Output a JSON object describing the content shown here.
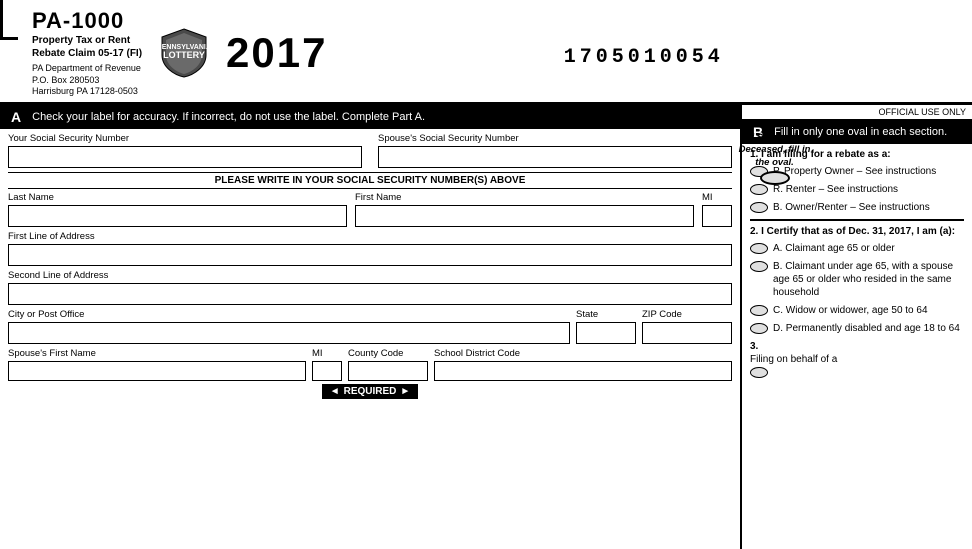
{
  "header": {
    "form_title": "PA-1000",
    "form_subtitle_line1": "Property Tax or Rent",
    "form_subtitle_line2": "Rebate Claim  05-17 (FI)",
    "dept_line1": "PA Department of Revenue",
    "dept_line2": "P.O. Box 280503",
    "dept_line3": "Harrisburg PA 17128-0503",
    "year": "2017",
    "barcode": "1705010054"
  },
  "sectionA": {
    "label": "A",
    "header_text": "Check your label for accuracy. If incorrect, do not use the label. Complete Part A.",
    "your_ssn_label": "Your Social Security Number",
    "spouse_ssn_label": "Spouse's Social Security Number",
    "deceased_label": "If Spouse is\nDeceased, fill\nin the oval.",
    "ssn_notice": "PLEASE WRITE IN YOUR SOCIAL SECURITY NUMBER(S) ABOVE",
    "last_name_label": "Last Name",
    "first_name_label": "First Name",
    "mi_label": "MI",
    "address1_label": "First Line of Address",
    "address2_label": "Second Line of Address",
    "city_label": "City or Post Office",
    "state_label": "State",
    "zip_label": "ZIP Code",
    "spouse_first_label": "Spouse's First Name",
    "spouse_mi_label": "MI",
    "county_label": "County Code",
    "school_district_label": "School District Code",
    "required_left_arrow": "◄",
    "required_text": "REQUIRED",
    "required_right_arrow": "►"
  },
  "sectionB": {
    "label": "B",
    "header_text": "Fill in only one oval in each section.",
    "official_use_text": "OFFICIAL USE ONLY",
    "question1": "1.  I am filing for a rebate as a:",
    "option_p": "P.  Property Owner – See instructions",
    "option_r": "R.  Renter – See instructions",
    "option_b": "B.  Owner/Renter – See instructions",
    "question2": "2.  I Certify that as of Dec. 31, 2017, I am (a):",
    "option_2a": "A.  Claimant age 65 or older",
    "option_2b": "B.  Claimant under age 65, with a spouse age 65 or older who resided in the same household",
    "option_2c": "C.  Widow or widower, age 50 to 64",
    "option_2d": "D.  Permanently disabled and age 18 to 64",
    "question3_label": "3.",
    "filing_text": "Filing on behalf of a"
  }
}
